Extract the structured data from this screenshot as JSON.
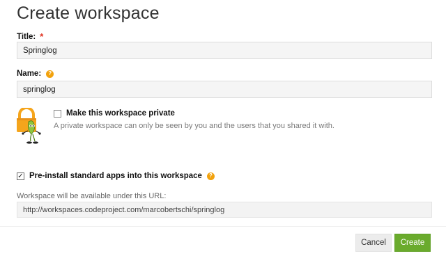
{
  "page": {
    "title": "Create workspace"
  },
  "form": {
    "title_field": {
      "label": "Title:",
      "required_mark": "*",
      "value": "Springlog"
    },
    "name_field": {
      "label": "Name:",
      "help_glyph": "?",
      "value": "springlog"
    },
    "private_option": {
      "label": "Make this workspace private",
      "checked": false,
      "description": "A private workspace can only be seen by you and the users that you shared it with."
    },
    "preinstall_option": {
      "label": "Pre-install standard apps into this workspace",
      "checked": true,
      "help_glyph": "?"
    },
    "url": {
      "caption": "Workspace will be available under this URL:",
      "value": "http://workspaces.codeproject.com/marcobertschi/springlog"
    }
  },
  "actions": {
    "cancel_label": "Cancel",
    "create_label": "Create"
  },
  "colors": {
    "accent_green": "#6aab2d",
    "help_orange": "#f2a20d",
    "required_red": "#e0301e",
    "lock_orange": "#f5a51c",
    "mascot_green": "#8dc63f"
  },
  "icons": {
    "help": "question-circle-icon",
    "lock": "padlock-mascot-icon",
    "check": "checkmark-icon"
  }
}
